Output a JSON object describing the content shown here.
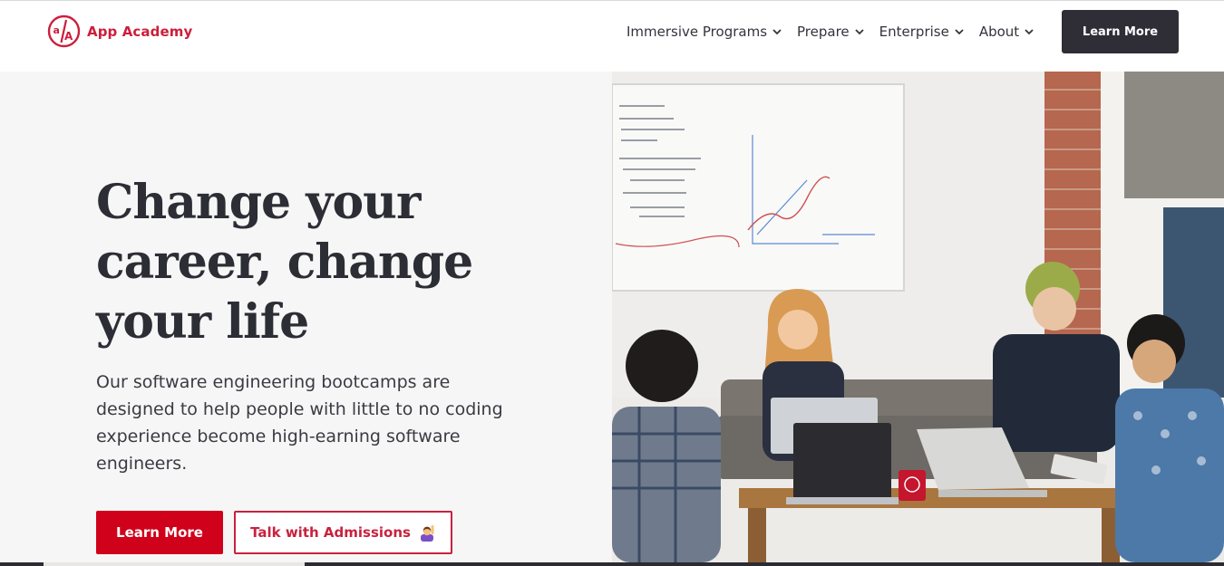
{
  "brand": {
    "name": "App Academy",
    "logo_icon": "app-academy-logo-icon",
    "color": "#cc1e3b"
  },
  "nav": {
    "items": [
      {
        "label": "Immersive Programs",
        "icon": "chevron-down-icon"
      },
      {
        "label": "Prepare",
        "icon": "chevron-down-icon"
      },
      {
        "label": "Enterprise",
        "icon": "chevron-down-icon"
      },
      {
        "label": "About",
        "icon": "chevron-down-icon"
      }
    ],
    "cta_label": "Learn More"
  },
  "hero": {
    "headline_lines": [
      "Change your",
      "career, change",
      "your life"
    ],
    "subtext": "Our software engineering bootcamps are designed to help people with little to no coding experience become high-earning software engineers.",
    "primary_button": "Learn More",
    "secondary_button": "Talk with Admissions",
    "secondary_icon": "person-raising-hand-emoji-icon",
    "photo": "students-working-on-laptops-photo"
  },
  "colors": {
    "accent": "#d0021b",
    "dark": "#2f2e37",
    "hero_bg": "#f7f6f6"
  }
}
